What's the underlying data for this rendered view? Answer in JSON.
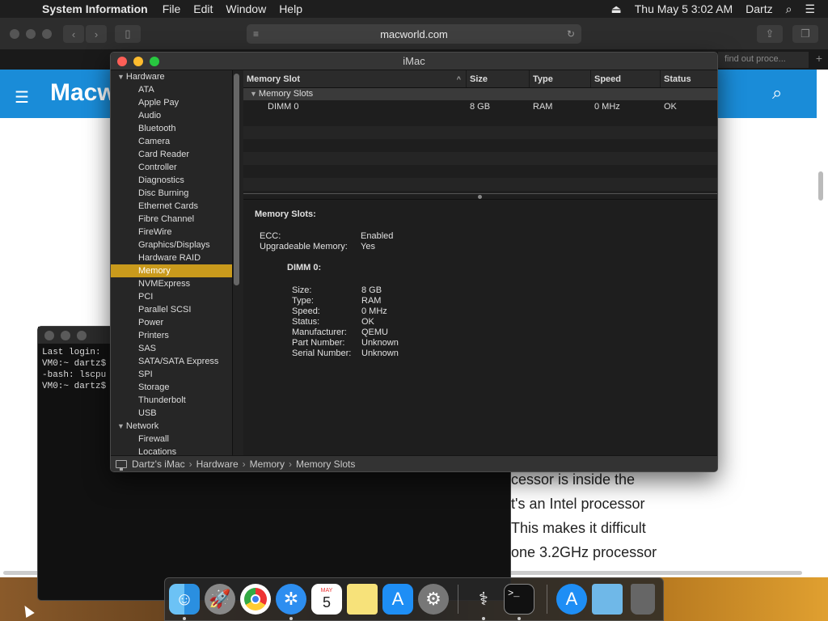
{
  "menubar": {
    "app_name": "System Information",
    "items": [
      "File",
      "Edit",
      "Window",
      "Help"
    ],
    "datetime": "Thu May 5  3:02 AM",
    "user": "Dartz"
  },
  "safari": {
    "url": "macworld.com",
    "tab_text": "find out proce...",
    "logo": "Macw",
    "article_lines": [
      "cessor is inside the",
      "t's an Intel processor",
      "This makes it difficult",
      "one 3.2GHz processor"
    ]
  },
  "terminal": {
    "lines": [
      "Last login:",
      "VM0:~ dartz$",
      "-bash: lscpu",
      "VM0:~ dartz$"
    ]
  },
  "sysinfo": {
    "title": "iMac",
    "sidebar": {
      "hardware_header": "Hardware",
      "hardware_items": [
        "ATA",
        "Apple Pay",
        "Audio",
        "Bluetooth",
        "Camera",
        "Card Reader",
        "Controller",
        "Diagnostics",
        "Disc Burning",
        "Ethernet Cards",
        "Fibre Channel",
        "FireWire",
        "Graphics/Displays",
        "Hardware RAID",
        "Memory",
        "NVMExpress",
        "PCI",
        "Parallel SCSI",
        "Power",
        "Printers",
        "SAS",
        "SATA/SATA Express",
        "SPI",
        "Storage",
        "Thunderbolt",
        "USB"
      ],
      "network_header": "Network",
      "network_items": [
        "Firewall",
        "Locations"
      ]
    },
    "table": {
      "headers": [
        "Memory Slot",
        "Size",
        "Type",
        "Speed",
        "Status"
      ],
      "group": "Memory Slots",
      "row": [
        "DIMM 0",
        "8 GB",
        "RAM",
        "0 MHz",
        "OK"
      ]
    },
    "detail": {
      "title": "Memory Slots:",
      "general": [
        {
          "k": "ECC:",
          "v": "Enabled"
        },
        {
          "k": "Upgradeable Memory:",
          "v": "Yes"
        }
      ],
      "dimm_header": "DIMM 0:",
      "dimm": [
        {
          "k": "Size:",
          "v": "8 GB"
        },
        {
          "k": "Type:",
          "v": "RAM"
        },
        {
          "k": "Speed:",
          "v": "0 MHz"
        },
        {
          "k": "Status:",
          "v": "OK"
        },
        {
          "k": "Manufacturer:",
          "v": "QEMU"
        },
        {
          "k": "Part Number:",
          "v": "Unknown"
        },
        {
          "k": "Serial Number:",
          "v": "Unknown"
        }
      ]
    },
    "breadcrumb": [
      "Dartz's iMac",
      "Hardware",
      "Memory",
      "Memory Slots"
    ]
  },
  "dock": {
    "calendar_month": "MAY",
    "calendar_day": "5",
    "apps": [
      "finder-icon",
      "launchpad-icon",
      "chrome-icon",
      "safari-icon",
      "calendar-icon",
      "notes-icon",
      "app-store-icon",
      "system-preferences-icon",
      "system-information-icon",
      "terminal-icon",
      "app-store-downloads-icon",
      "folder-icon",
      "trash-icon"
    ]
  },
  "colors": {
    "selection": "#c99a1c",
    "site_header": "#1a8cd8",
    "close": "#fe5f57",
    "minimize": "#febc2e",
    "maximize": "#28c840"
  }
}
